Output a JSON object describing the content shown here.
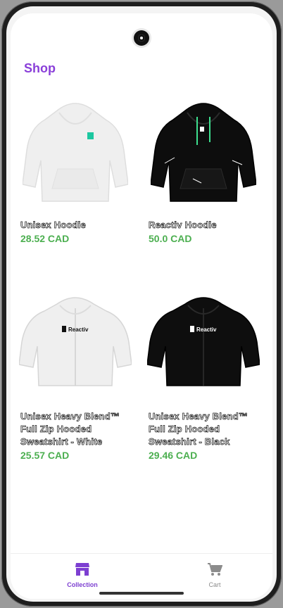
{
  "header": {
    "title": "Shop"
  },
  "products": [
    {
      "name": "Unisex Hoodie",
      "price": "28.52 CAD",
      "image": "white-hoodie-icon"
    },
    {
      "name": "Reactiv Hoodie",
      "price": "50.0 CAD",
      "image": "black-hoodie-icon"
    },
    {
      "name": "Unisex Heavy Blend™ Full Zip Hooded Sweatshirt - White",
      "price": "25.57 CAD",
      "image": "white-zip-hoodie-icon"
    },
    {
      "name": "Unisex Heavy Blend™ Full Zip Hooded Sweatshirt - Black",
      "price": "29.46 CAD",
      "image": "black-zip-hoodie-icon"
    }
  ],
  "products_logo_text": "Reactiv",
  "tabbar": {
    "collection": {
      "label": "Collection",
      "icon": "storefront-icon"
    },
    "cart": {
      "label": "Cart",
      "icon": "cart-icon"
    }
  },
  "colors": {
    "accent": "#8a3fd9",
    "price": "#4caf50"
  }
}
